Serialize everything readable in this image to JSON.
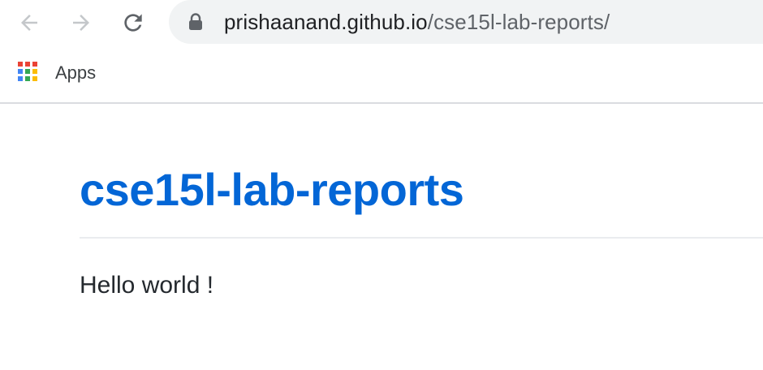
{
  "browser": {
    "url_host": "prishaanand.github.io",
    "url_path": "/cse15l-lab-reports/",
    "icons": {
      "back": "arrow-left-icon",
      "forward": "arrow-right-icon",
      "reload": "reload-icon",
      "lock": "lock-icon"
    }
  },
  "bookmarks": {
    "apps_label": "Apps",
    "apps_icon_colors": [
      "#ea4335",
      "#ea4335",
      "#ea4335",
      "#4285f4",
      "#34a853",
      "#fbbc05",
      "#4285f4",
      "#34a853",
      "#fbbc05"
    ]
  },
  "page": {
    "title": "cse15l-lab-reports",
    "body": "Hello world !",
    "title_color": "#0366d6"
  }
}
